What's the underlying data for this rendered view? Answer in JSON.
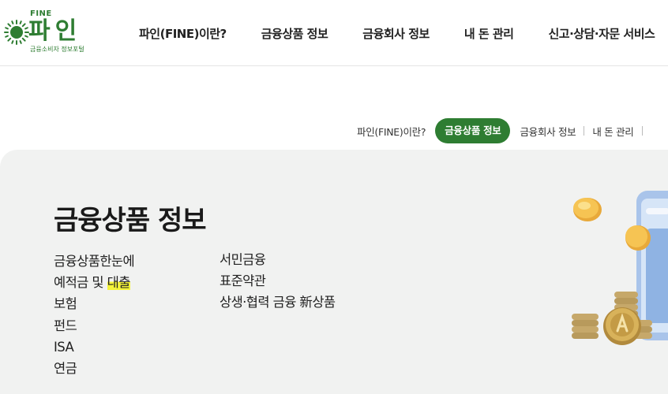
{
  "header": {
    "logo": {
      "fine": "FINE",
      "main": "파인",
      "sub": "금융소비자 정보포털"
    },
    "nav": [
      {
        "label": "파인(FINE)이란?"
      },
      {
        "label": "금융상품 정보"
      },
      {
        "label": "금융회사 정보"
      },
      {
        "label": "내 돈 관리"
      },
      {
        "label": "신고·상담·자문 서비스"
      }
    ]
  },
  "tabs": {
    "items": [
      {
        "label": "파인(FINE)이란?"
      },
      {
        "label": "금융상품 정보",
        "active": true
      },
      {
        "label": "금융회사 정보"
      },
      {
        "label": "내 돈 관리"
      }
    ]
  },
  "panel": {
    "title": "금융상품 정보",
    "col1": [
      {
        "label": "금융상품한눈에"
      },
      {
        "label_a": "예적금 및 ",
        "label_b": "대출"
      },
      {
        "label": "보험"
      },
      {
        "label": "펀드"
      },
      {
        "label": "ISA"
      },
      {
        "label": "연금"
      }
    ],
    "col2": [
      {
        "label": "서민금융"
      },
      {
        "label": "표준약관"
      },
      {
        "label": "상생·협력 금융 新상품"
      }
    ]
  },
  "colors": {
    "brand_green": "#2e7d32",
    "highlight": "#f4f43a",
    "panel_bg": "#f1f2f1"
  }
}
